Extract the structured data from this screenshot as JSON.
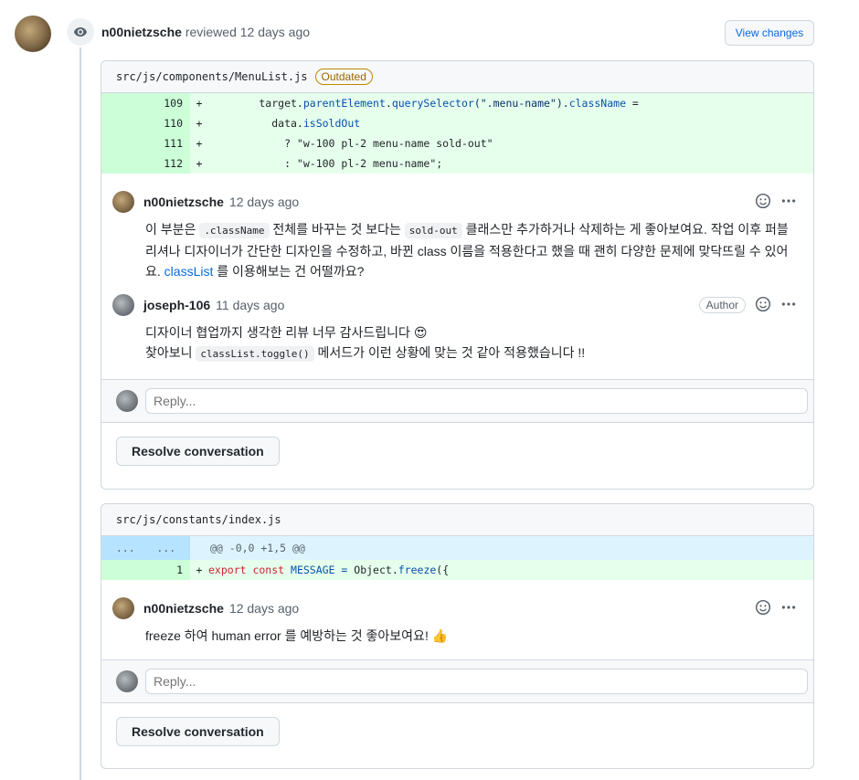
{
  "review": {
    "reviewer": "n00nietzsche",
    "action": "reviewed",
    "time": "12 days ago",
    "view_changes_label": "View changes"
  },
  "threads": [
    {
      "file_path": "src/js/components/MenuList.js",
      "outdated_label": "Outdated",
      "diff_lines": [
        {
          "line": "109",
          "sign": "+"
        },
        {
          "line": "110",
          "sign": "+"
        },
        {
          "line": "111",
          "sign": "+"
        },
        {
          "line": "112",
          "sign": "+"
        }
      ],
      "code": {
        "l109_a": "        target.",
        "l109_b": "parentElement",
        "l109_c": ".",
        "l109_d": "querySelector",
        "l109_e": "(\".menu-name\").",
        "l109_f": "className",
        "l109_g": " =",
        "l110_a": "          data.",
        "l110_b": "isSoldOut",
        "l111": "            ? \"w-100 pl-2 menu-name sold-out\"",
        "l112": "            : \"w-100 pl-2 menu-name\";"
      },
      "comments": [
        {
          "author": "n00nietzsche",
          "time": "12 days ago",
          "body_1": "이 부분은 ",
          "code_1": ".className",
          "body_2": " 전체를 바꾸는 것 보다는 ",
          "code_2": "sold-out",
          "body_3": " 클래스만 추가하거나 삭제하는 게 좋아보여요. 작업 이후 퍼블리셔나 디자이너가 간단한 디자인을 수정하고, 바뀐 class 이름을 적용한다고 했을 때 괜히 다양한 문제에 맞닥뜨릴 수 있어요. ",
          "link": "classList",
          "body_4": " 를 이용해보는 건 어떨까요?"
        },
        {
          "author": "joseph-106",
          "time": "11 days ago",
          "badge": "Author",
          "line1": "디자이너 협업까지 생각한 리뷰 너무 감사드립니다 😍",
          "body_1": "찾아보니 ",
          "code_1": "classList.toggle()",
          "body_2": " 메서드가 이런 상황에 맞는 것 같아 적용했습니다 !!"
        }
      ],
      "reply_placeholder": "Reply...",
      "resolve_label": "Resolve conversation"
    },
    {
      "file_path": "src/js/constants/index.js",
      "hunk": {
        "left": "...",
        "right": "...",
        "header": "@@ -0,0 +1,5 @@"
      },
      "diff_line": {
        "line": "1",
        "sign": "+"
      },
      "code": {
        "a": "export const",
        "b": " MESSAGE = ",
        "c": "Object",
        "d": ".",
        "e": "freeze",
        "f": "({"
      },
      "comments": [
        {
          "author": "n00nietzsche",
          "time": "12 days ago",
          "body": "freeze 하여 human error 를 예방하는 것 좋아보여요! 👍"
        }
      ],
      "reply_placeholder": "Reply...",
      "resolve_label": "Resolve conversation"
    }
  ]
}
